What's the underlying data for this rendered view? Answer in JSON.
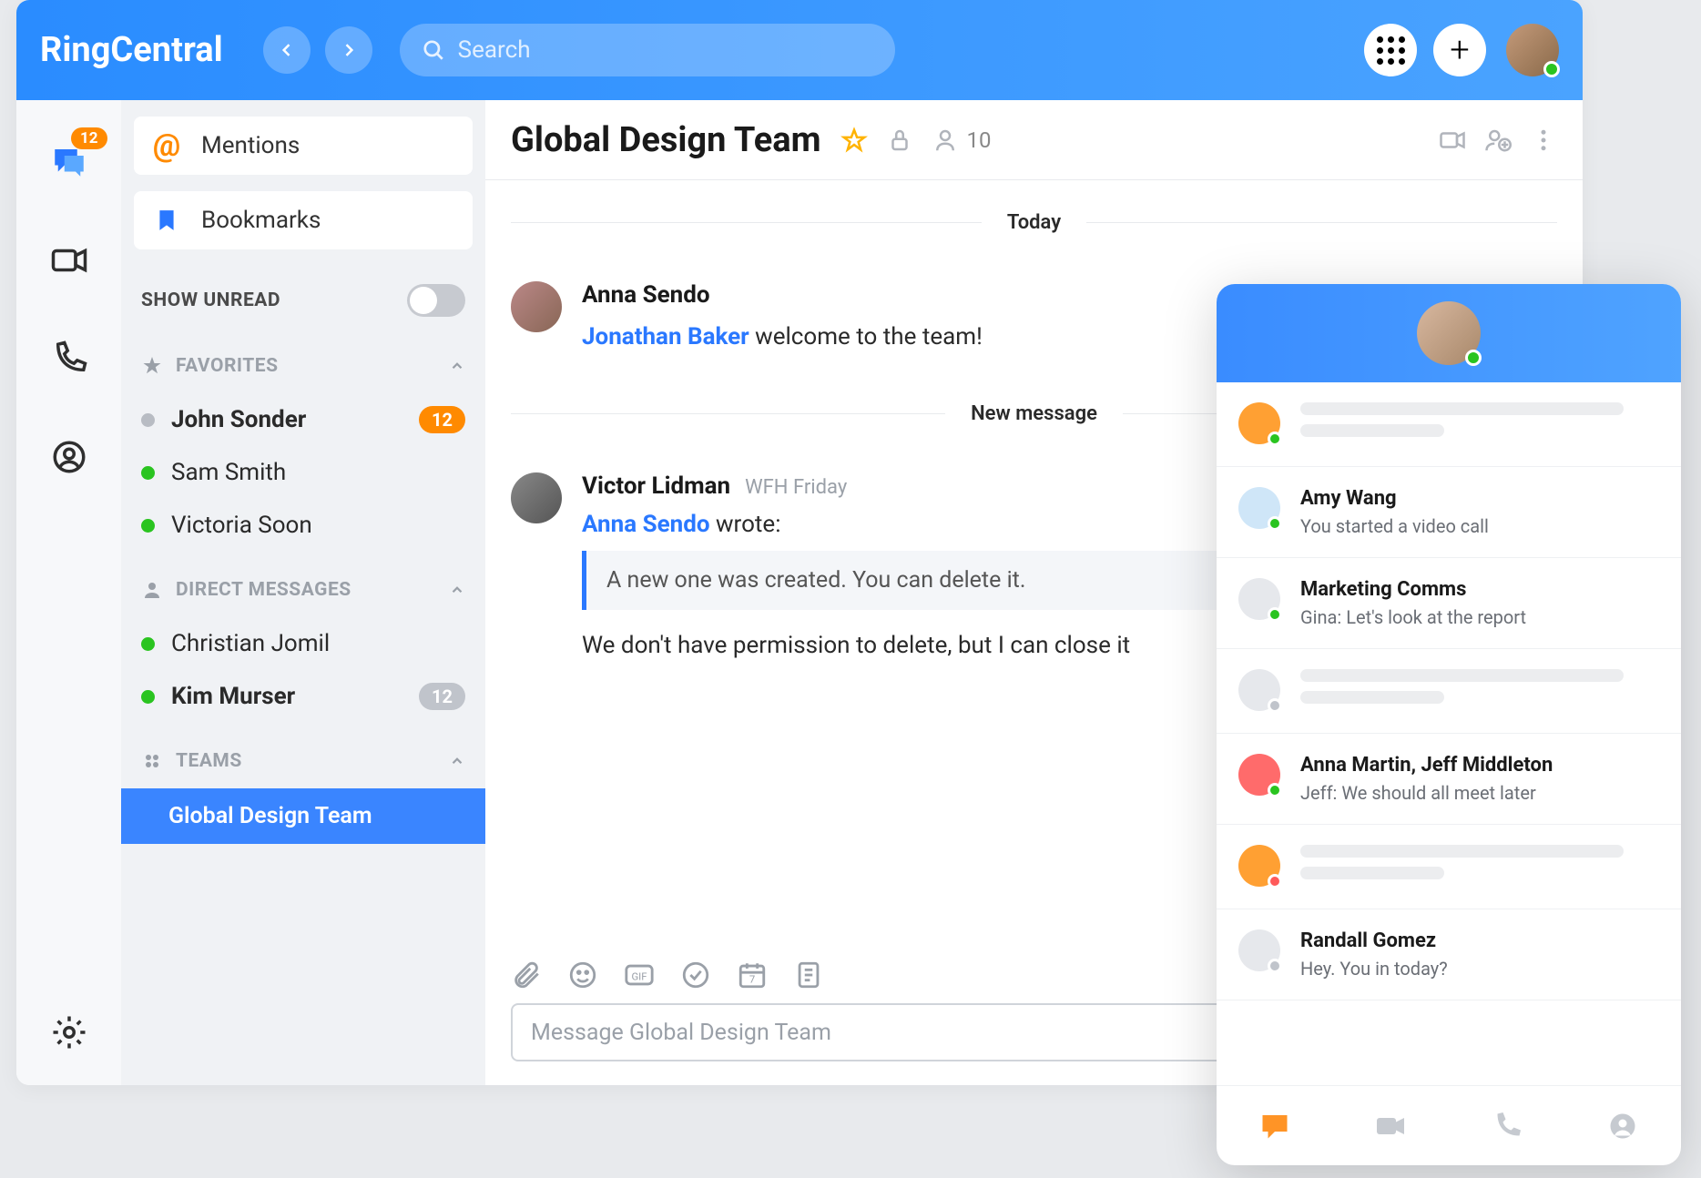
{
  "brand": "RingCentral",
  "search": {
    "placeholder": "Search"
  },
  "rail": {
    "chat_badge": "12"
  },
  "sidebar": {
    "mentions_label": "Mentions",
    "bookmarks_label": "Bookmarks",
    "show_unread_label": "SHOW UNREAD",
    "sections": {
      "favorites": {
        "label": "FAVORITES",
        "items": [
          {
            "name": "John Sonder",
            "badge": "12",
            "presence": "gray",
            "bold": true
          },
          {
            "name": "Sam Smith",
            "presence": "green"
          },
          {
            "name": "Victoria Soon",
            "presence": "green"
          }
        ]
      },
      "dms": {
        "label": "DIRECT MESSAGES",
        "items": [
          {
            "name": "Christian Jomil",
            "presence": "green"
          },
          {
            "name": "Kim Murser",
            "presence": "green",
            "badge": "12",
            "badge_gray": true,
            "bold": true
          }
        ]
      },
      "teams": {
        "label": "TEAMS",
        "items": [
          {
            "name": "Global Design Team",
            "selected": true
          }
        ]
      }
    }
  },
  "chat": {
    "title": "Global Design Team",
    "member_count": "10",
    "dividers": {
      "today": "Today",
      "new": "New message"
    },
    "messages": [
      {
        "author": "Anna Sendo",
        "mention": "Jonathan Baker",
        "text_after": " welcome to the team!"
      },
      {
        "author": "Victor Lidman",
        "status": "WFH Friday",
        "quote_by": "Anna Sendo",
        "quote_verb": " wrote:",
        "quote_text": "A new one was created. You can delete it.",
        "text": "We don't have permission to delete, but I can close it"
      }
    ],
    "compose_placeholder": "Message Global Design Team"
  },
  "mobile": {
    "items": [
      {
        "color": "orange",
        "pres": "g",
        "skeleton": true
      },
      {
        "color": "lblue",
        "pres": "g",
        "name": "Amy Wang",
        "text": "You started a video call"
      },
      {
        "color": "lgray",
        "pres": "g",
        "name": "Marketing Comms",
        "text": "Gina: Let's look at the report"
      },
      {
        "color": "lgray",
        "pres": "gr",
        "skeleton": true
      },
      {
        "color": "red",
        "pres": "g",
        "name": "Anna Martin, Jeff Middleton",
        "text": "Jeff: We should all meet later"
      },
      {
        "color": "orange",
        "pres": "r",
        "skeleton": true
      },
      {
        "color": "lgray",
        "pres": "gr",
        "name": "Randall Gomez",
        "text": "Hey. You in today?"
      }
    ]
  }
}
